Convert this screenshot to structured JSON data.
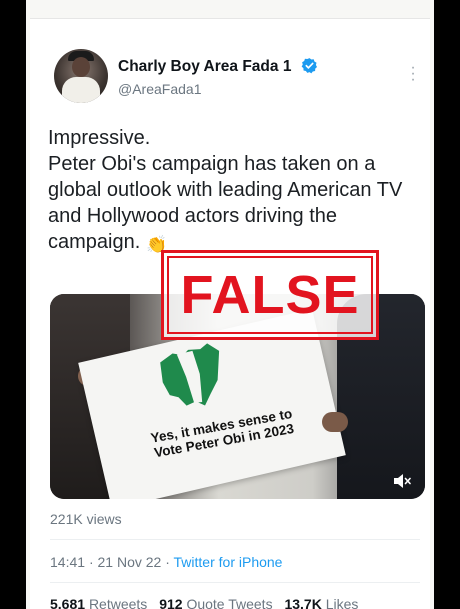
{
  "tweet": {
    "author_name": "Charly Boy Area Fada 1",
    "author_handle": "@AreaFada1",
    "text_line1": "Impressive.",
    "text_line2": "Peter Obi's campaign has taken on a global outlook with leading American TV and Hollywood actors driving the campaign.",
    "emoji": "clapping-hands",
    "media": {
      "sign_text": "Yes, it makes sense to\nVote Peter Obi in 2023",
      "mute_icon": "speaker-muted-icon"
    },
    "views": "221K views",
    "time": "14:41",
    "separator": "·",
    "date": "21 Nov 22",
    "source": "Twitter for iPhone",
    "stats": {
      "retweets_count": "5,681",
      "retweets_label": "Retweets",
      "quotes_count": "912",
      "quotes_label": "Quote Tweets",
      "likes_count": "13.7K",
      "likes_label": "Likes"
    }
  },
  "stamp": {
    "label": "FALSE",
    "color": "#e2141f"
  },
  "colors": {
    "verified": "#1d9bf0",
    "link": "#1d9bf0",
    "muted_text": "#6b7680"
  }
}
